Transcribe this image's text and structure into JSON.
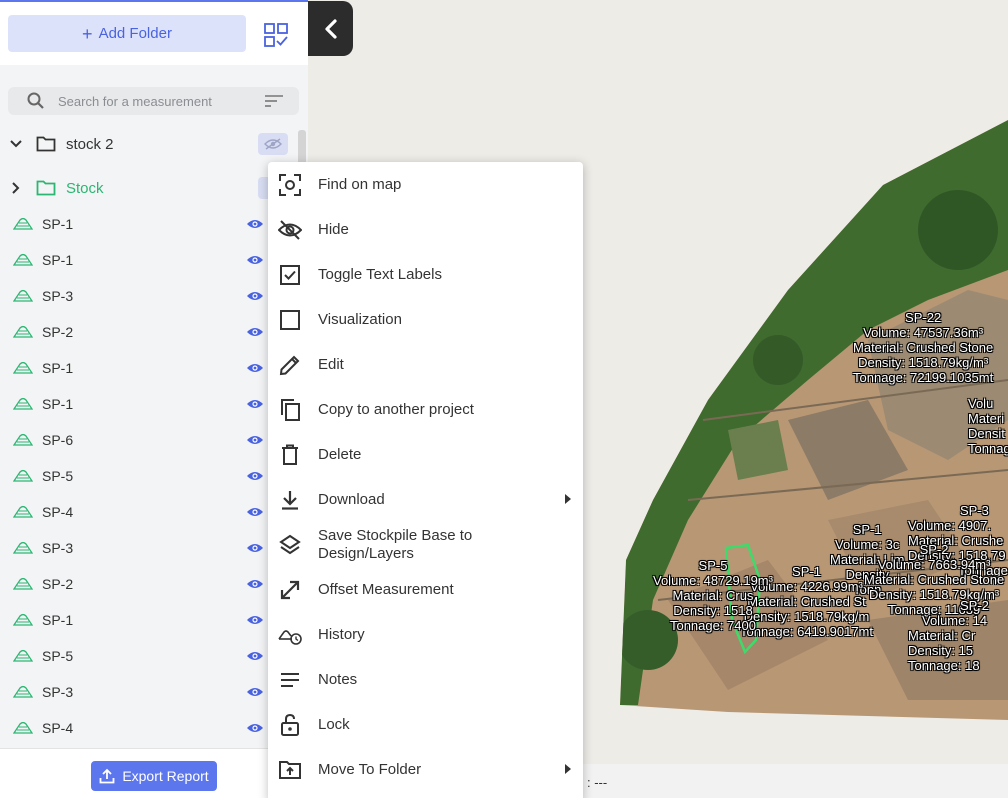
{
  "sidebar": {
    "add_folder_label": "Add Folder",
    "search_placeholder": "Search for a measurement",
    "folders": [
      {
        "name": "stock 2"
      },
      {
        "name": "Stock"
      }
    ],
    "items": [
      {
        "label": "SP-1"
      },
      {
        "label": "SP-1"
      },
      {
        "label": "SP-3"
      },
      {
        "label": "SP-2"
      },
      {
        "label": "SP-1"
      },
      {
        "label": "SP-1"
      },
      {
        "label": "SP-6"
      },
      {
        "label": "SP-5"
      },
      {
        "label": "SP-4"
      },
      {
        "label": "SP-3"
      },
      {
        "label": "SP-2"
      },
      {
        "label": "SP-1"
      },
      {
        "label": "SP-5"
      },
      {
        "label": "SP-3"
      },
      {
        "label": "SP-4"
      }
    ],
    "export_label": "Export Report"
  },
  "menu": {
    "items": [
      {
        "label": "Find on map",
        "icon": "find-on-map-icon"
      },
      {
        "label": "Hide",
        "icon": "eye-off-icon"
      },
      {
        "label": "Toggle Text Labels",
        "icon": "checkbox-checked-icon"
      },
      {
        "label": "Visualization",
        "icon": "checkbox-empty-icon"
      },
      {
        "label": "Edit",
        "icon": "pencil-icon"
      },
      {
        "label": "Copy to another project",
        "icon": "copy-icon"
      },
      {
        "label": "Delete",
        "icon": "trash-icon"
      },
      {
        "label": "Download",
        "icon": "download-icon"
      },
      {
        "label": "Save Stockpile Base to Design/Layers",
        "icon": "layers-icon"
      },
      {
        "label": "Offset Measurement",
        "icon": "offset-arrows-icon"
      },
      {
        "label": "History",
        "icon": "history-icon"
      },
      {
        "label": "Notes",
        "icon": "notes-icon"
      },
      {
        "label": "Lock",
        "icon": "lock-icon"
      },
      {
        "label": "Move To Folder",
        "icon": "move-folder-icon"
      }
    ]
  },
  "map": {
    "coord_readout": ": ---",
    "labels": {
      "sp22": [
        "SP-22",
        "Volume: 47537.36m³",
        "Material: Crushed Stone",
        "Density: 1518.79kg/m³",
        "Tonnage: 72199.1035mt"
      ],
      "sp3": [
        "SP-3",
        "Volume: 4907.",
        "Material: Crushe",
        "Density: 1518.79",
        "Tonnage:"
      ],
      "sp1a": [
        "SP-1",
        "Volume: 3c",
        "Material: Lim",
        "Density",
        "Tonn"
      ],
      "sp2": [
        "SP-2",
        "Volume: 7663.94m³",
        "Material: Crushed Stone",
        "Density: 1518.79kg/m³",
        "Tonnage: 11639"
      ],
      "sp1b": [
        "SP-1",
        "Volume: 4226.99m³",
        "Material: Crushed St",
        "Density: 1518.79kg/m",
        "Tonnage: 6419.9017mt"
      ],
      "sp5": [
        "SP-5",
        "Volume: 48729.19m³",
        "Material: Crus",
        "Density: 1518",
        "Tonnage: 7400"
      ],
      "spr": [
        "Volu",
        "Materi",
        "Densit",
        "Tonnag"
      ],
      "sp2b": [
        "SP-2",
        "Volume: 14",
        "Material: Cr",
        "Density: 15",
        "Tonnage: 18"
      ]
    },
    "colors": {
      "sidebar_accent": "#5c76ee",
      "folder_green": "#2bb673",
      "outline_green": "#3ddc6a"
    }
  }
}
